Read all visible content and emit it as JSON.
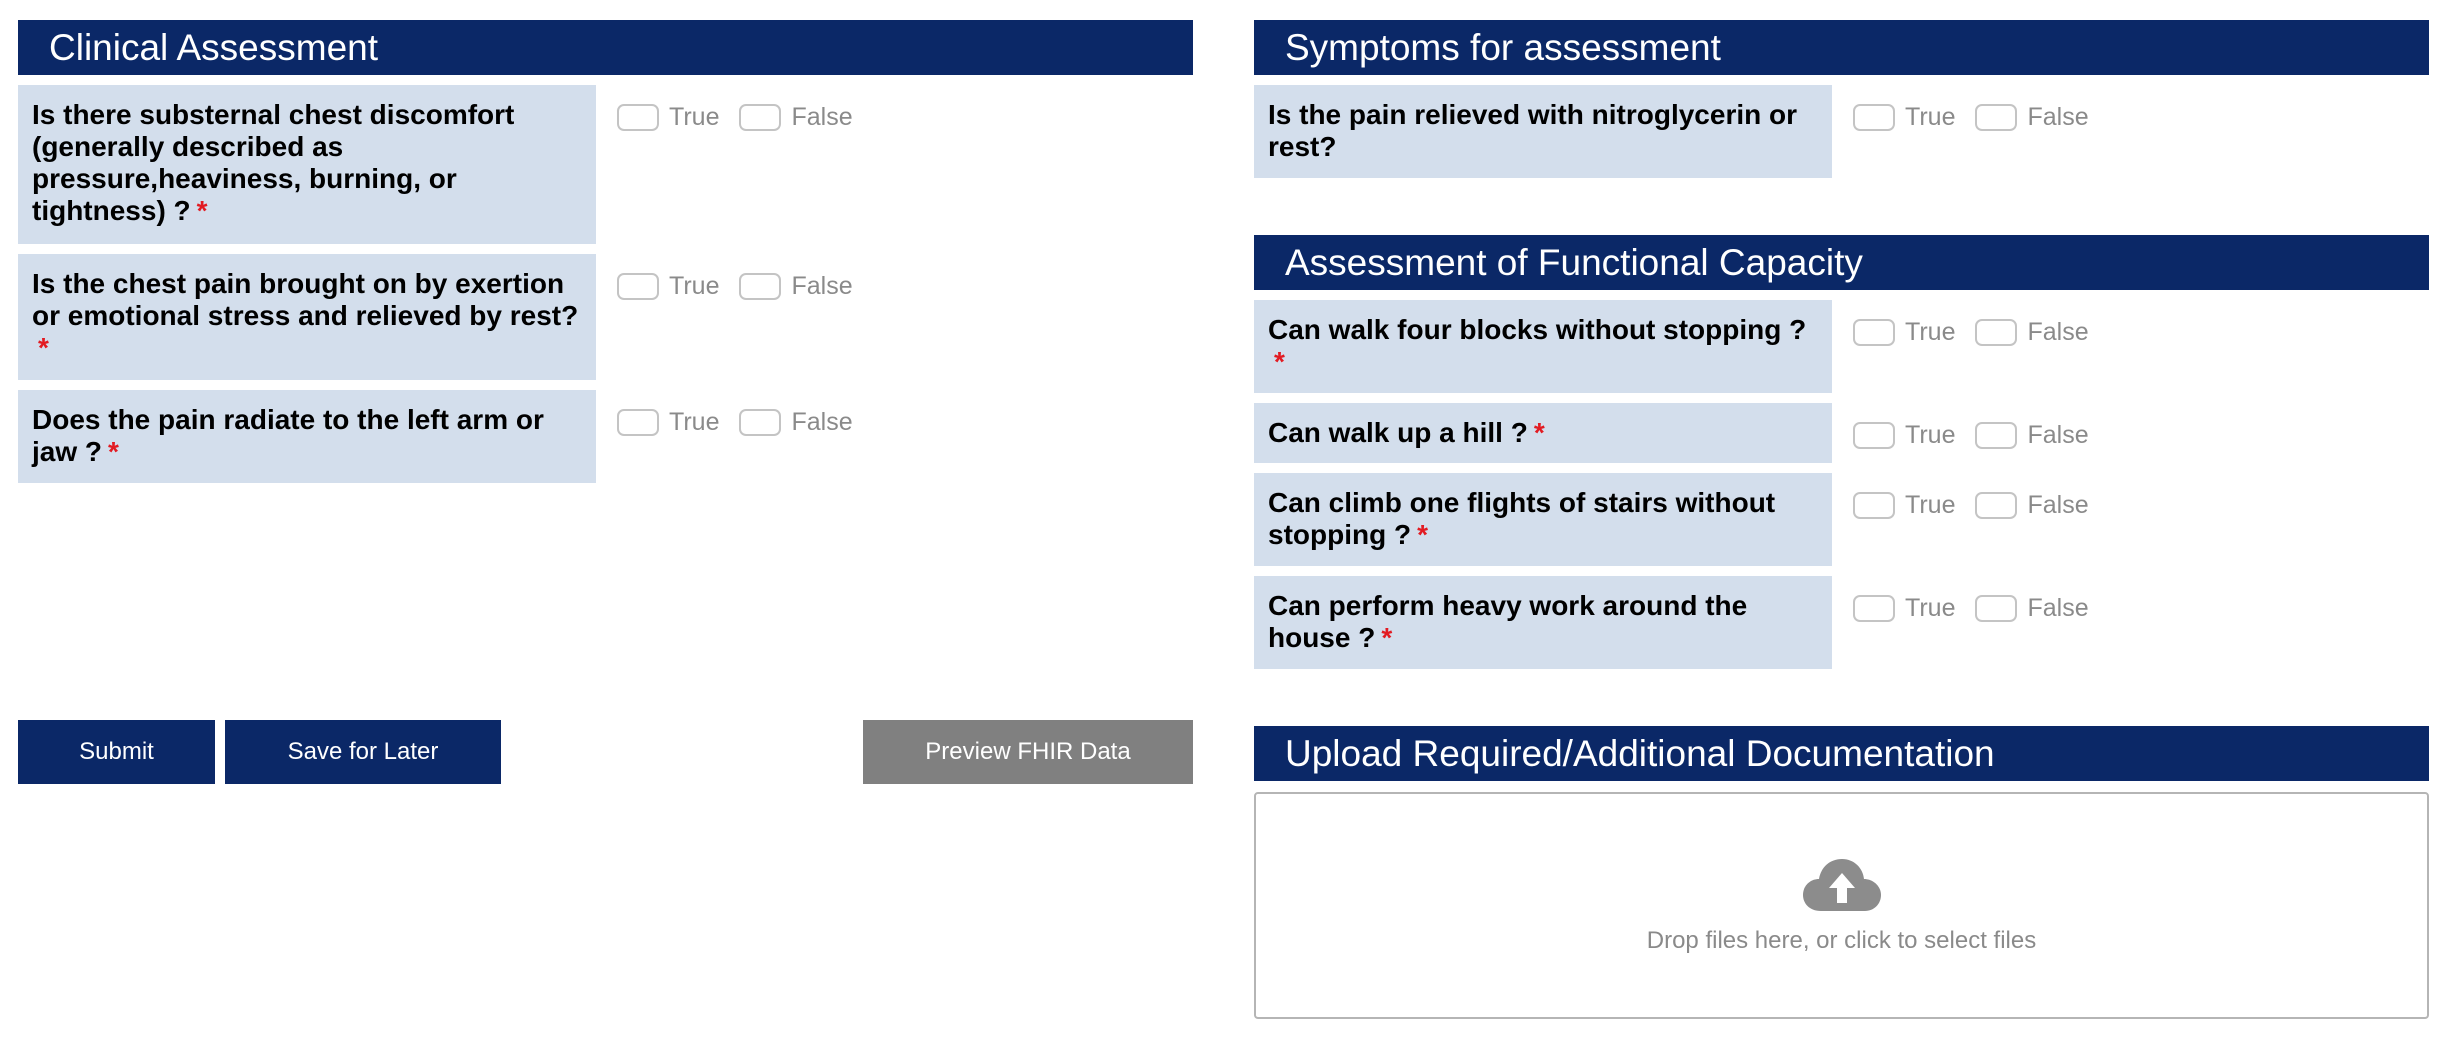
{
  "clinical": {
    "title": "Clinical Assessment",
    "questions": [
      {
        "text": "Is there substernal chest discomfort (generally described as pressure,heaviness, burning, or tightness) ?",
        "required": "*"
      },
      {
        "text": "Is the chest pain brought on by exertion or emotional stress and relieved by rest?",
        "required": "*"
      },
      {
        "text": "Does the pain radiate to the left arm or jaw ?",
        "required": "*"
      }
    ]
  },
  "options": {
    "true_label": "True",
    "false_label": "False"
  },
  "symptoms": {
    "title": "Symptoms for assessment",
    "questions": [
      {
        "text": "Is the pain relieved with nitroglycerin or rest?"
      }
    ]
  },
  "functional": {
    "title": "Assessment of Functional Capacity",
    "questions": [
      {
        "text": "Can walk four blocks without stopping ?",
        "required": "*"
      },
      {
        "text": "Can walk up a hill ?",
        "required": "*"
      },
      {
        "text": "Can climb one flights of stairs without stopping ?",
        "required": "*"
      },
      {
        "text": "Can perform heavy work around the house ?",
        "required": "*"
      }
    ]
  },
  "buttons": {
    "submit": "Submit",
    "save": "Save for Later",
    "preview": "Preview FHIR Data"
  },
  "upload": {
    "title": "Upload Required/Additional Documentation",
    "drop_text": "Drop files here, or click to select files",
    "icon": "cloud-upload-icon"
  },
  "colors": {
    "header_bg": "#0b2867",
    "label_bg": "#d3deec",
    "required": "#e21b22",
    "preview_btn": "#808080"
  }
}
